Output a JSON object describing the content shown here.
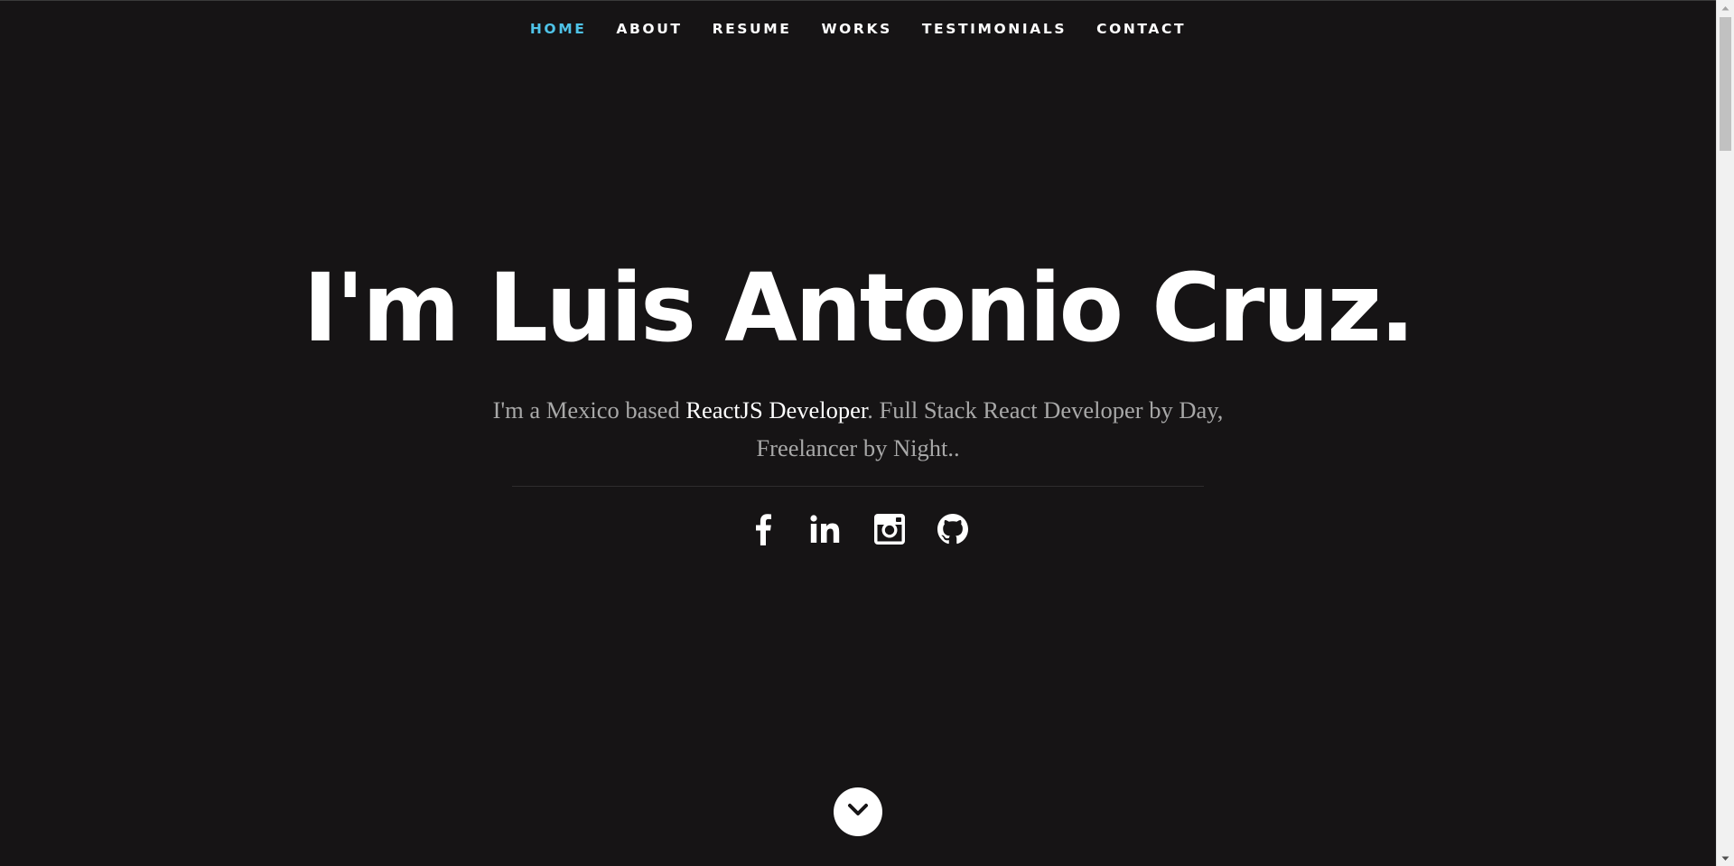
{
  "nav": {
    "items": [
      {
        "label": "HOME",
        "active": true
      },
      {
        "label": "ABOUT",
        "active": false
      },
      {
        "label": "RESUME",
        "active": false
      },
      {
        "label": "WORKS",
        "active": false
      },
      {
        "label": "TESTIMONIALS",
        "active": false
      },
      {
        "label": "CONTACT",
        "active": false
      }
    ],
    "active_color": "#4fc3e8"
  },
  "hero": {
    "headline": "I'm Luis Antonio Cruz.",
    "intro_before": "I'm a Mexico based ",
    "intro_highlight": "ReactJS Developer",
    "intro_after": ". Full Stack React Developer by Day, Freelancer by Night.."
  },
  "social": [
    {
      "icon": "facebook-icon"
    },
    {
      "icon": "linkedin-icon"
    },
    {
      "icon": "instagram-icon"
    },
    {
      "icon": "github-icon"
    }
  ],
  "scroll_down": {
    "icon": "chevron-down-icon"
  },
  "colors": {
    "background": "#161415",
    "text": "#ffffff",
    "muted_text": "#a8a8a8",
    "accent": "#4fc3e8"
  }
}
